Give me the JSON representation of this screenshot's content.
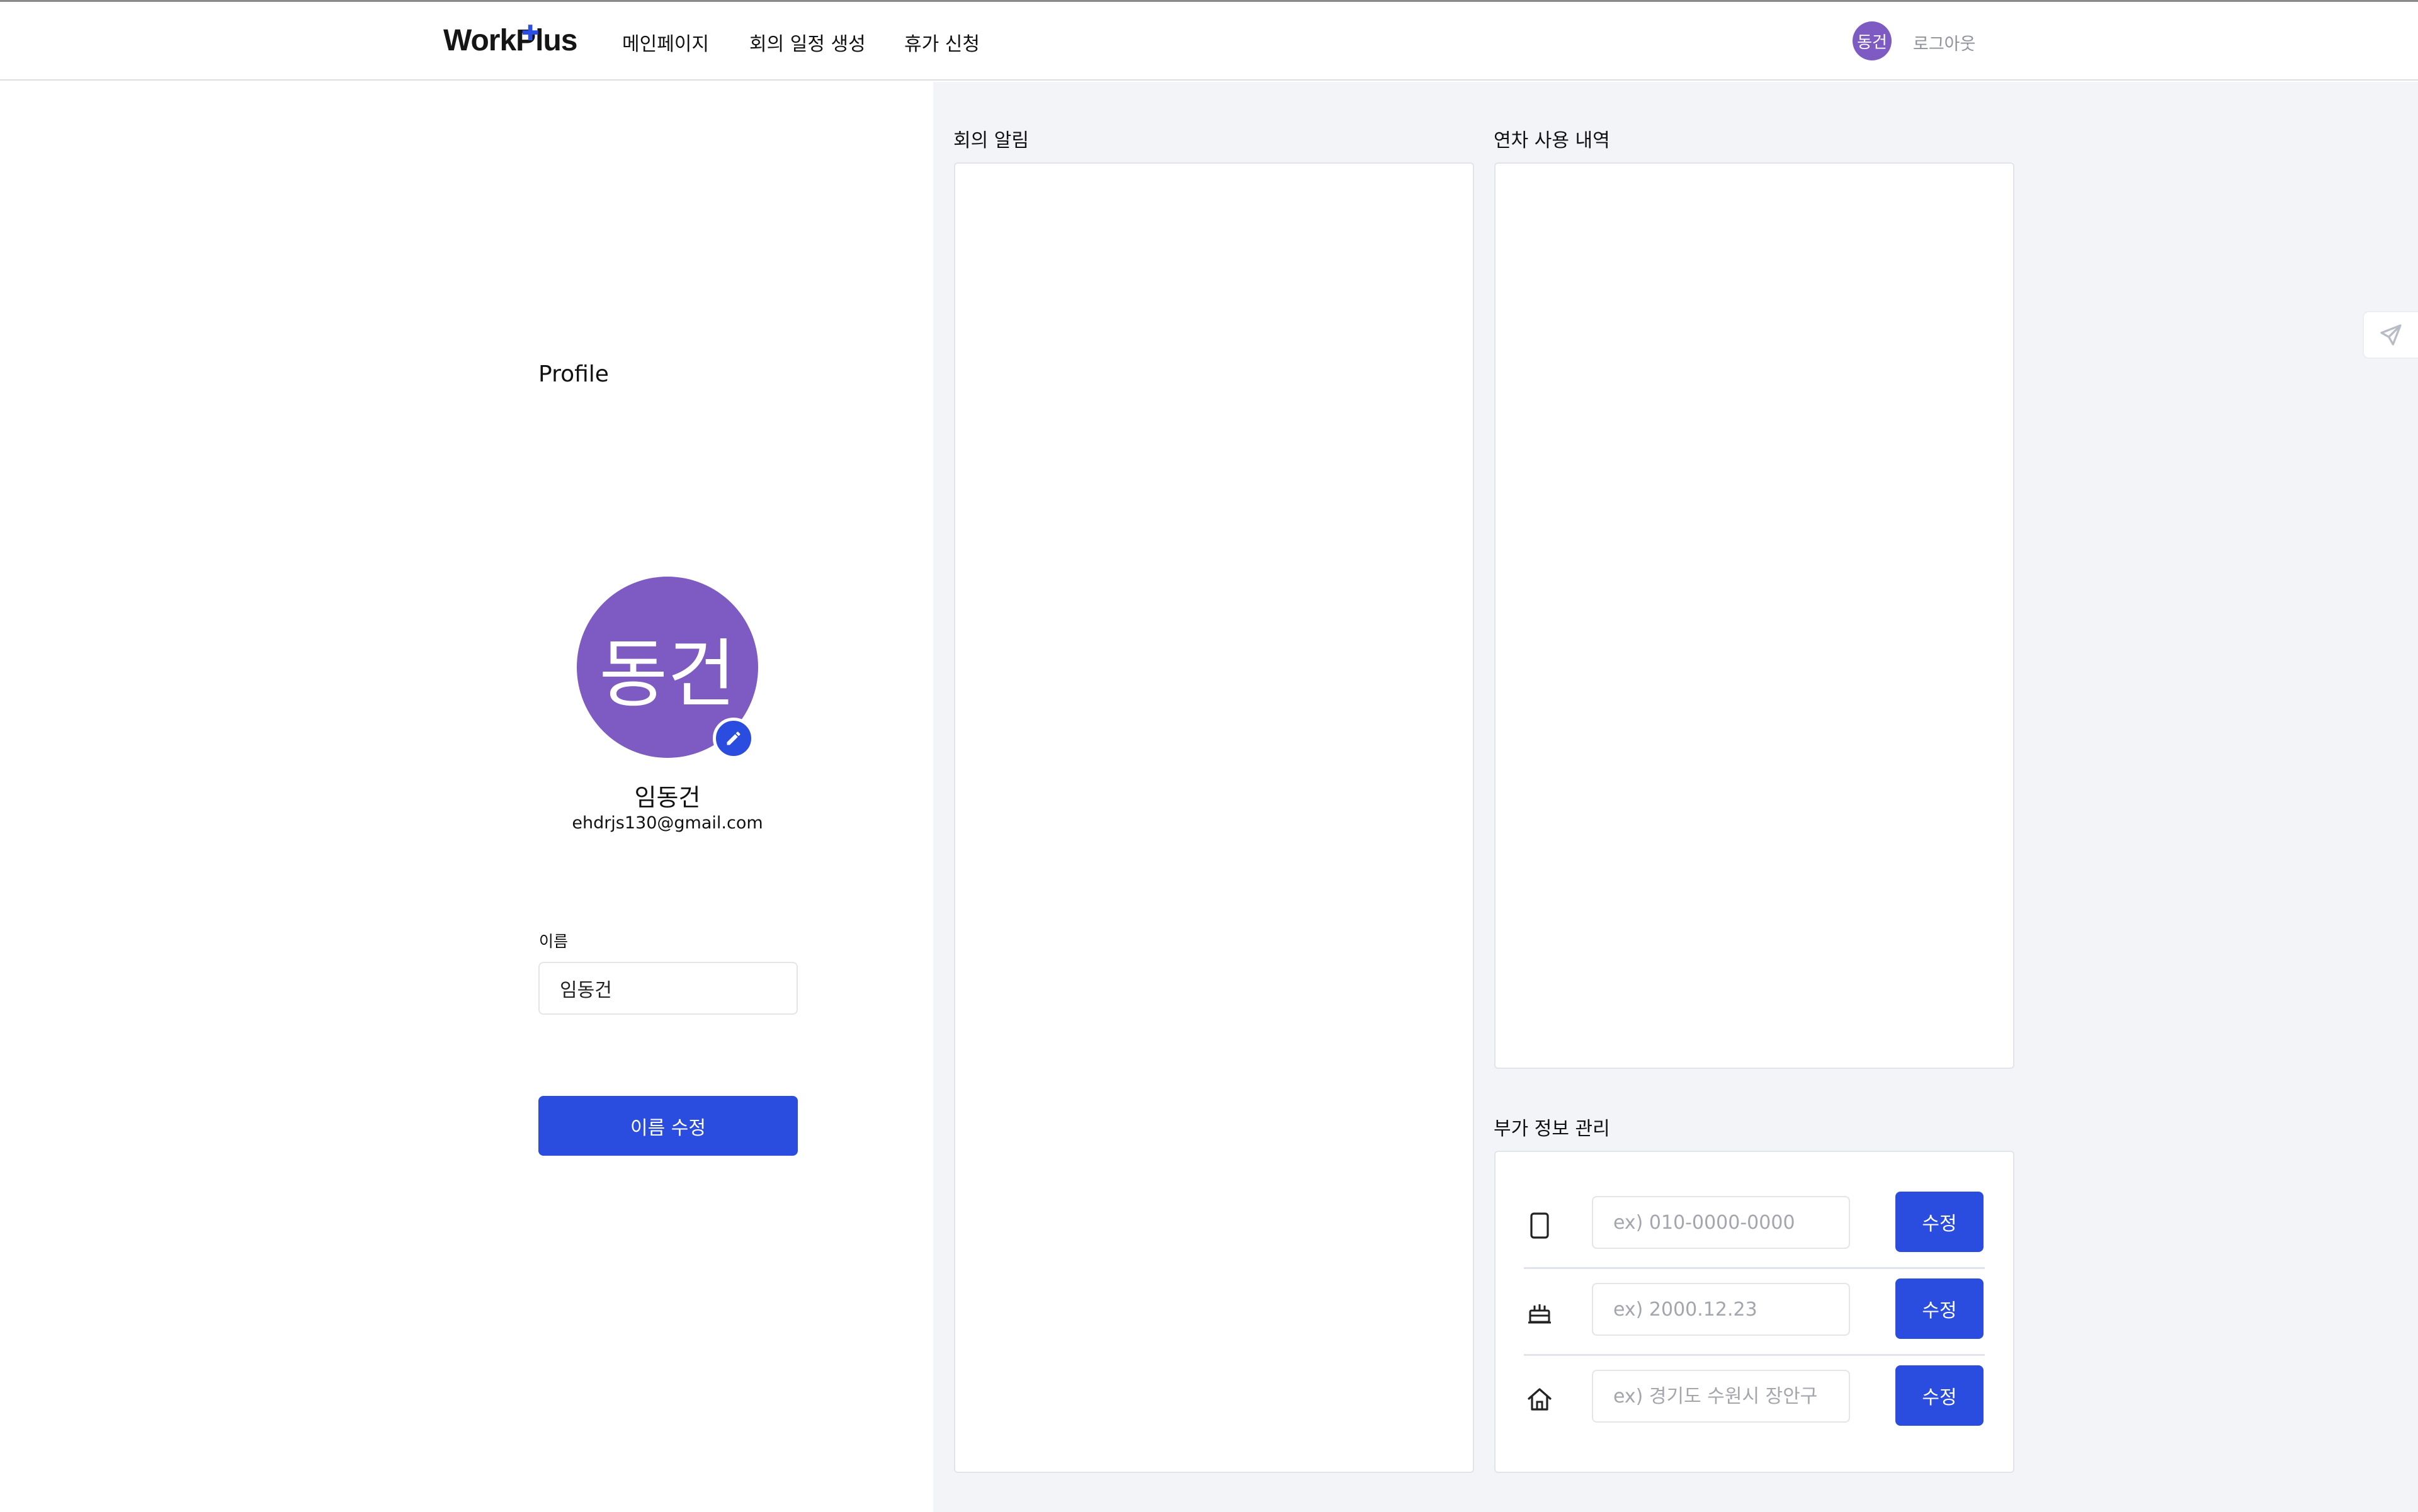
{
  "header": {
    "logo": "WorkPlus",
    "nav": {
      "home": "메인페이지",
      "meeting": "회의 일정 생성",
      "leave": "휴가 신청"
    },
    "user_avatar": "동건",
    "logout": "로그아웃"
  },
  "profile": {
    "title": "Profile",
    "avatar_text": "동건",
    "name": "임동건",
    "email": "ehdrjs130@gmail.com",
    "name_label": "이름",
    "name_value": "임동건",
    "save_button": "이름 수정"
  },
  "sections": {
    "meetings_title": "회의 알림",
    "leave_history_title": "연차 사용 내역",
    "extra_info_title": "부가 정보 관리"
  },
  "extra_info": {
    "phone": {
      "icon": "phone-icon",
      "placeholder": "ex) 010-0000-0000",
      "button": "수정"
    },
    "birthday": {
      "icon": "cake-icon",
      "placeholder": "ex) 2000.12.23",
      "button": "수정"
    },
    "address": {
      "icon": "home-icon",
      "placeholder": "ex) 경기도 수원시 장안구",
      "button": "수정"
    }
  },
  "side_tab": {
    "icon": "send-icon"
  },
  "colors": {
    "accent": "#2a4de0",
    "avatar": "#7e5bc2",
    "panel_bg": "#f2f4f8"
  }
}
